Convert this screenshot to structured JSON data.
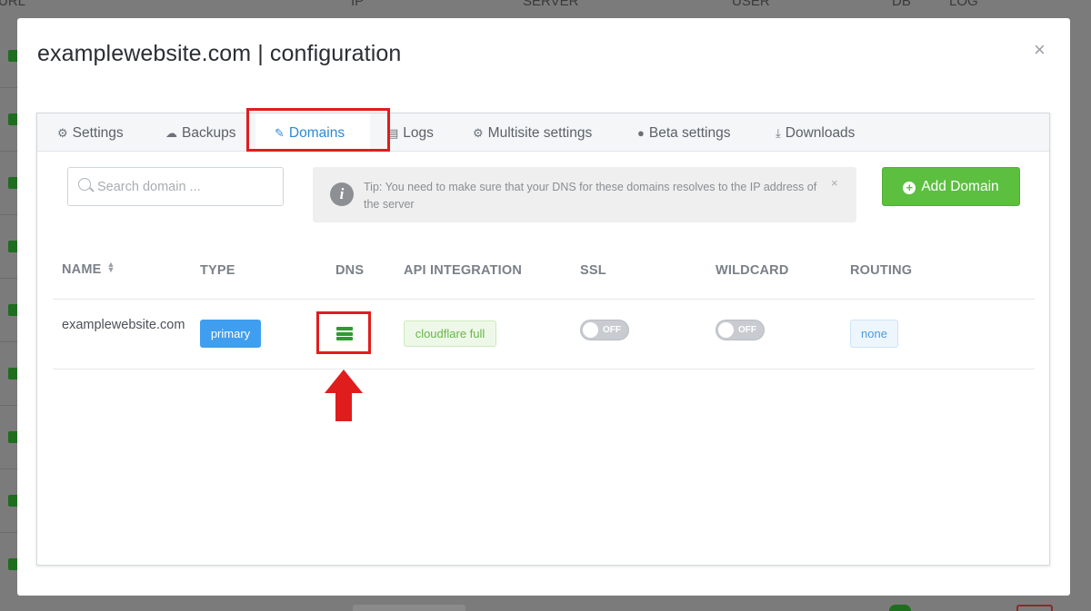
{
  "background": {
    "columns": [
      "URL",
      "IP",
      "SERVER",
      "USER",
      "DB",
      "LOG"
    ]
  },
  "modal": {
    "title": "examplewebsite.com | configuration",
    "close_glyph": "×"
  },
  "tabs": [
    {
      "label": "Settings",
      "icon": "gear-icon",
      "active": false
    },
    {
      "label": "Backups",
      "icon": "cloud-icon",
      "active": false
    },
    {
      "label": "Domains",
      "icon": "edit-icon",
      "active": true
    },
    {
      "label": "Logs",
      "icon": "file-icon",
      "active": false
    },
    {
      "label": "Multisite settings",
      "icon": "gear-icon",
      "active": false
    },
    {
      "label": "Beta settings",
      "icon": "exclamation-icon",
      "active": false
    },
    {
      "label": "Downloads",
      "icon": "download-icon",
      "active": false
    }
  ],
  "search": {
    "placeholder": "Search domain ...",
    "value": ""
  },
  "tip": {
    "text": "Tip: You need to make sure that your DNS for these domains resolves to the IP address of the server",
    "close_glyph": "×"
  },
  "add_domain": {
    "label": "Add Domain"
  },
  "table": {
    "headers": [
      "NAME",
      "TYPE",
      "DNS",
      "API INTEGRATION",
      "SSL",
      "WILDCARD",
      "ROUTING"
    ],
    "rows": [
      {
        "name": "examplewebsite.com",
        "type": "primary",
        "dns": "server-icon",
        "api_integration": "cloudflare full",
        "ssl": "OFF",
        "wildcard": "OFF",
        "routing": "none"
      }
    ]
  },
  "colors": {
    "accent_blue": "#2d8ad6",
    "add_button_green": "#5cbf3f",
    "highlight_red": "#e01d1d",
    "dns_icon_green": "#2e9b2e"
  }
}
